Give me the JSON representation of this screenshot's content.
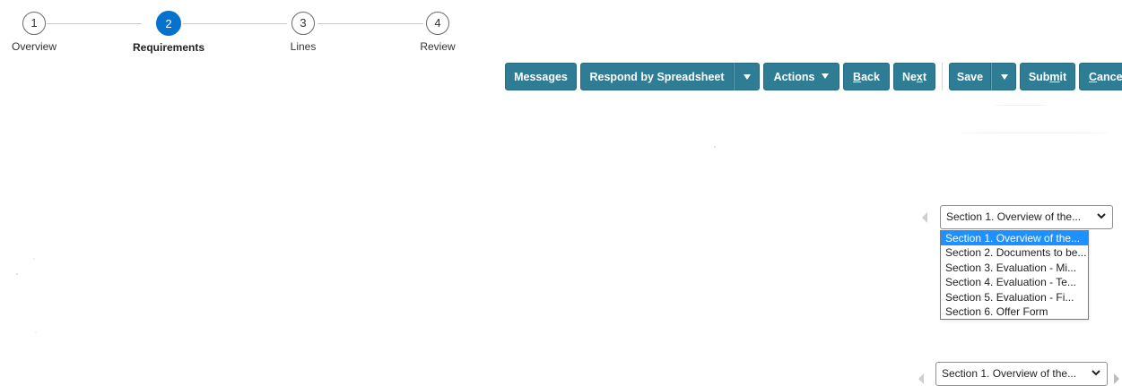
{
  "train": {
    "stops": [
      {
        "number": "1",
        "label": "Overview"
      },
      {
        "number": "2",
        "label": "Requirements"
      },
      {
        "number": "3",
        "label": "Lines"
      },
      {
        "number": "4",
        "label": "Review"
      }
    ],
    "active_index": 1
  },
  "toolbar": {
    "messages": "Messages",
    "respond_by_spreadsheet": "Respond by Spreadsheet",
    "actions": "Actions",
    "back_pre": "",
    "back_key": "B",
    "back_post": "ack",
    "next_pre": "Ne",
    "next_key": "x",
    "next_post": "t",
    "save": "Save",
    "submit_pre": "Sub",
    "submit_key": "m",
    "submit_post": "it",
    "cancel_pre": "",
    "cancel_key": "C",
    "cancel_post": "ance"
  },
  "section_select_top": {
    "value": "Section 1. Overview of the...",
    "options": [
      "Section 1. Overview of the...",
      "Section 2. Documents to be...",
      "Section 3. Evaluation - Mi...",
      "Section 4. Evaluation - Te...",
      "Section 5. Evaluation - Fi...",
      "Section 6. Offer Form"
    ],
    "highlighted_index": 0
  },
  "section_select_bottom": {
    "value": "Section 1. Overview of the..."
  },
  "colors": {
    "accent": "#0572ce",
    "button": "#2f7c95",
    "dropdown_highlight": "#1e90ff"
  }
}
